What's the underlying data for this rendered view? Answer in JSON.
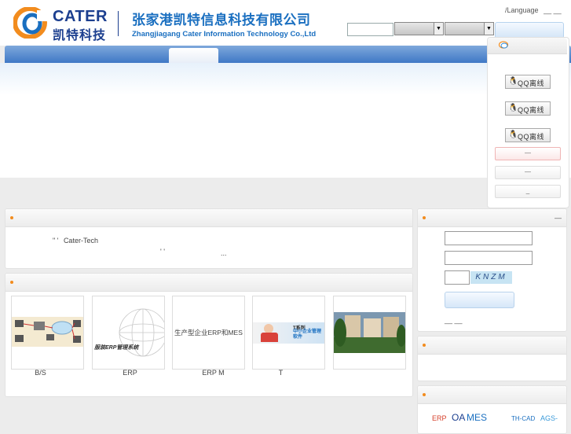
{
  "header": {
    "logo_en": "CATER",
    "logo_cn": "凯特科技",
    "company_cn": "张家港凯特信息科技有限公司",
    "company_en": "Zhangjiagang Cater Information Technology Co.,Ltd",
    "language_label": "/Language",
    "language_links": "__ __"
  },
  "qq_panel": {
    "buttons": [
      "QQ离线",
      "QQ离线",
      "QQ离线"
    ],
    "bars": [
      "—",
      "—",
      "_"
    ]
  },
  "intro": {
    "line1_marks": "\"   '",
    "line1_text": "Cater-Tech",
    "line2_marks": "'      '",
    "line2_ellipsis": "..."
  },
  "products": {
    "thumb2_caption": "服装ERP管理系统",
    "thumb3_caption": "生产型企业ERP和MES",
    "thumb4_title": "T系列",
    "thumb4_sub": "中小企业管理软件",
    "captcha": "KNZM",
    "labels": [
      "B/S",
      "ERP",
      "ERP M",
      "T",
      ""
    ]
  },
  "login": {
    "footer_links": "__ __"
  },
  "links": {
    "items": [
      "ERP",
      "OA",
      "MES",
      "TH-CAD",
      "AGS-"
    ]
  },
  "colors": {
    "brand_blue": "#1a6fc0",
    "logo_navy": "#1c3f8f",
    "nav_blue": "#3f78c6",
    "bullet_orange": "#f28c1e"
  }
}
